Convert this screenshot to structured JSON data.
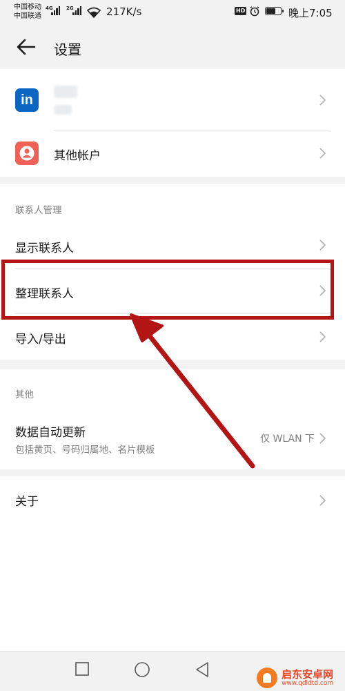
{
  "status_bar": {
    "carrier_1": "中国移动",
    "carrier_2": "中国联通",
    "net_1": "4G",
    "net_2": "2G",
    "speed": "217K/s",
    "hd": "HD",
    "time": "晚上7:05",
    "battery_level": 0.6
  },
  "header": {
    "title": "设置"
  },
  "accounts": {
    "linkedin_icon_text": "in",
    "other_accounts_label": "其他帐户"
  },
  "contacts_section": {
    "title": "联系人管理",
    "items": [
      {
        "label": "显示联系人"
      },
      {
        "label": "整理联系人"
      },
      {
        "label": "导入/导出"
      }
    ]
  },
  "other_section": {
    "title": "其他",
    "auto_update_label": "数据自动更新",
    "auto_update_sub": "包括黄页、号码归属地、名片模板",
    "auto_update_value": "仅 WLAN 下"
  },
  "about": {
    "label": "关于"
  },
  "watermark": {
    "text": "启东安卓网",
    "url": "www.qdldtd.com"
  },
  "colors": {
    "highlight": "#b31515",
    "linkedin": "#0a66c2",
    "contact_icon": "#ef6157"
  }
}
